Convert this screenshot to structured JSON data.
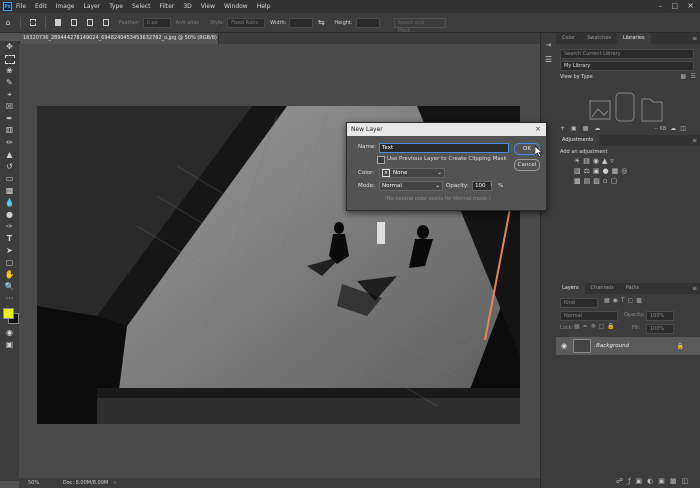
{
  "menubar": {
    "logo": "Ps",
    "items": [
      "File",
      "Edit",
      "Image",
      "Layer",
      "Type",
      "Select",
      "Filter",
      "3D",
      "View",
      "Window",
      "Help"
    ]
  },
  "options_bar": {
    "feather_label": "Feather:",
    "feather_value": "0 px",
    "antialias_label": "Anti-alias",
    "style_label": "Style:",
    "style_value": "Fixed Ratio",
    "width_label": "Width:",
    "height_label": "Height:",
    "select_mask_label": "Select and Mask..."
  },
  "document": {
    "tab_title": "18320736_289444278149024_6948240453453632782_o.jpg @ 50% (RGB/8)",
    "tab_close": "×"
  },
  "status": {
    "zoom": "50%",
    "doc": "Doc: 8.00M/8.00M"
  },
  "tools": [
    "move",
    "marquee",
    "lasso",
    "quick-select",
    "crop",
    "eyedropper",
    "heal",
    "brush",
    "stamp",
    "history",
    "eraser",
    "gradient",
    "blur",
    "dodge",
    "pen",
    "type",
    "path-select",
    "shape",
    "hand",
    "zoom",
    "more"
  ],
  "colors": {
    "foreground": "#e6f021",
    "background": "#111111",
    "accent": "#31a8ff",
    "arrow": "#e8845a"
  },
  "libraries_panel": {
    "tabs": [
      "Color",
      "Swatches",
      "Libraries"
    ],
    "active_tab": "Libraries",
    "search_placeholder": "Search Current Library",
    "library_select": "My Library",
    "view_by": "View by Type",
    "size_label": "-- KB"
  },
  "adjustments_panel": {
    "tab": "Adjustments",
    "add_label": "Add an adjustment"
  },
  "layers_panel": {
    "tabs": [
      "Layers",
      "Channels",
      "Paths"
    ],
    "active_tab": "Layers",
    "kind_placeholder": "Kind",
    "blend_mode": "Normal",
    "opacity_label": "Opacity:",
    "opacity_value": "100%",
    "lock_label": "Lock:",
    "fill_label": "Fill:",
    "fill_value": "100%",
    "layer_name": "Background"
  },
  "dialog": {
    "title": "New Layer",
    "close": "×",
    "name_label": "Name:",
    "name_value": "Text",
    "clip_label": "Use Previous Layer to Create Clipping Mask",
    "color_label": "Color:",
    "color_value": "None",
    "mode_label": "Mode:",
    "mode_value": "Normal",
    "opacity_label": "Opacity:",
    "opacity_value": "100",
    "opacity_unit": "%",
    "note": "(No neutral color exists for Normal mode.)",
    "ok_label": "OK",
    "cancel_label": "Cancel"
  }
}
